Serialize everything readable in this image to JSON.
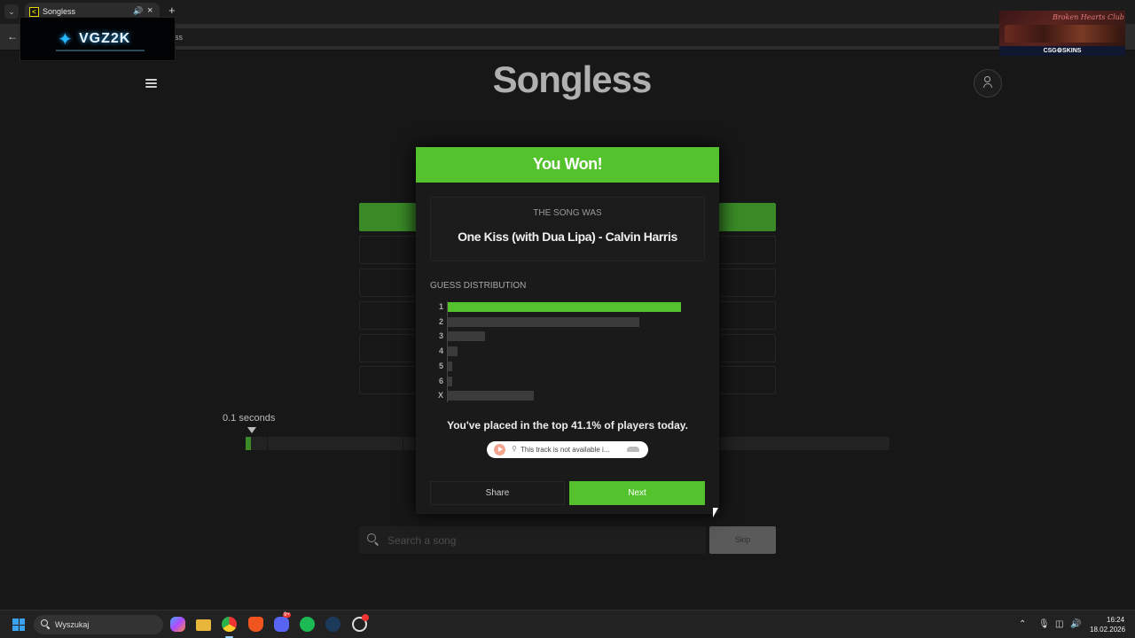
{
  "browser": {
    "tab_title": "Songless",
    "url_tail": "ss"
  },
  "stream_overlay": {
    "handle": "VGZ2K",
    "sponsor_script": "Broken Hearts Club",
    "sponsor_brand": "CSG⚙SKINS"
  },
  "header": {
    "title": "Songless"
  },
  "game": {
    "seconds_label": "0.1 seconds",
    "progress_fraction": 0.008,
    "search_placeholder": "Search a song",
    "skip_label": "Skip"
  },
  "modal": {
    "title": "You Won!",
    "song_label": "THE SONG WAS",
    "song_name": "One Kiss (with Dua Lipa) - Calvin Harris",
    "distribution_title": "GUESS DISTRIBUTION",
    "placed_text": "You've placed in the top 41.1% of players today.",
    "embed_text": "This track is not available i...",
    "share_label": "Share",
    "next_label": "Next"
  },
  "chart_data": {
    "type": "bar",
    "orientation": "horizontal",
    "title": "GUESS DISTRIBUTION",
    "categories": [
      "1",
      "2",
      "3",
      "4",
      "5",
      "6",
      "X"
    ],
    "values": [
      100,
      82,
      16,
      4,
      2,
      2,
      37
    ],
    "highlighted_category": "1",
    "colors": {
      "highlight": "#53c22d",
      "default": "#3b3b3b"
    }
  },
  "taskbar": {
    "search_text": "Wyszukaj",
    "discord_badge": "9+",
    "time": "16:24",
    "date": "18.02.2026"
  },
  "colors": {
    "accent_green": "#53c22d",
    "background": "#171717"
  }
}
